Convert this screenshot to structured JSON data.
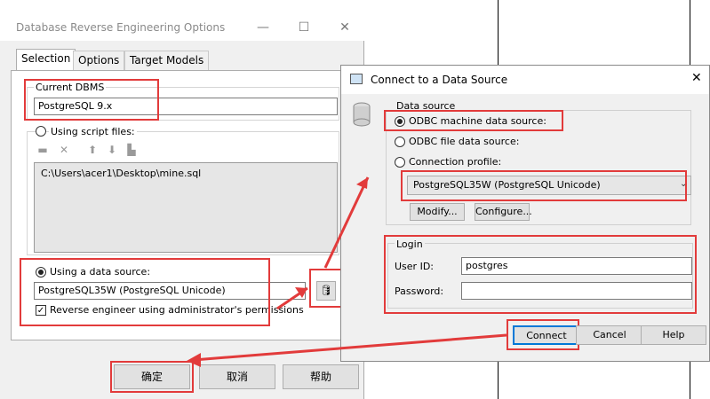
{
  "dialog1": {
    "title": "Database Reverse Engineering Options",
    "tabs": [
      "Selection",
      "Options",
      "Target Models"
    ],
    "current_dbms_label": "Current DBMS",
    "current_dbms_value": "PostgreSQL 9.x",
    "using_script_files_label": "Using script files:",
    "script_file_path": "C:\\Users\\acer1\\Desktop\\mine.sql",
    "using_data_source_label": "Using a data source:",
    "data_source_value": "PostgreSQL35W (PostgreSQL Unicode)",
    "admin_permissions_label": "Reverse engineer using administrator's permissions",
    "buttons": {
      "ok": "确定",
      "cancel": "取消",
      "help": "帮助"
    }
  },
  "dialog2": {
    "title": "Connect to a Data Source",
    "data_source_group": "Data source",
    "odbc_machine": "ODBC machine data source:",
    "odbc_file": "ODBC file data source:",
    "connection_profile": "Connection profile:",
    "selected_source": "PostgreSQL35W (PostgreSQL Unicode)",
    "modify_button": "Modify...",
    "configure_button": "Configure...",
    "login_group": "Login",
    "user_id_label": "User ID:",
    "user_id_value": "postgres",
    "password_label": "Password:",
    "password_value": "",
    "buttons": {
      "connect": "Connect",
      "cancel": "Cancel",
      "help": "Help"
    }
  },
  "colors": {
    "highlight": "#e23b3b",
    "dialog_bg": "#f0f0f0"
  }
}
